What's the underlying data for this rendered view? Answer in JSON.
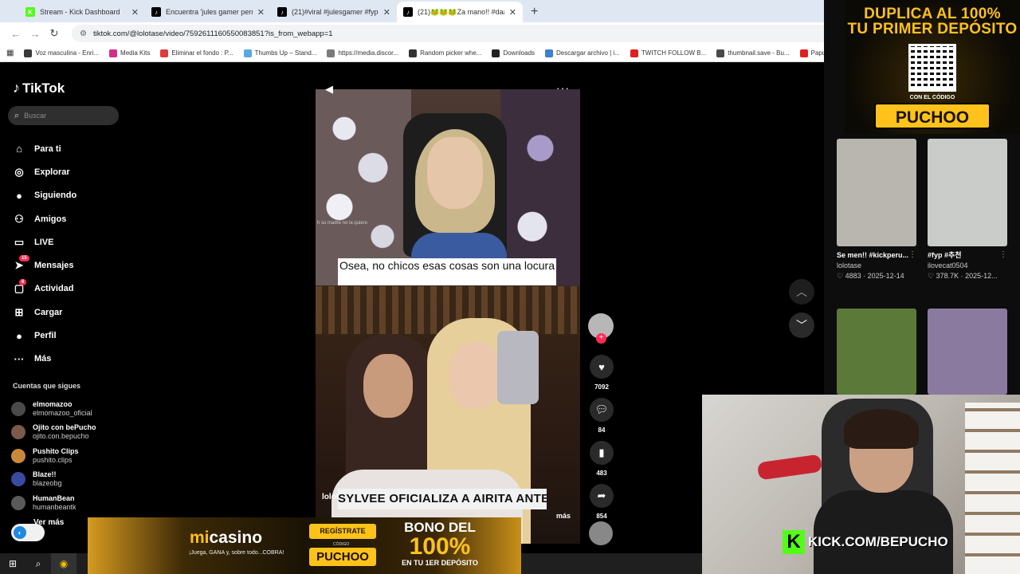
{
  "browser": {
    "tabs": [
      {
        "title": "Stream - Kick Dashboard",
        "color": "#53fc18",
        "glyph": "K"
      },
      {
        "title": "Encuentra 'jules gamer perro' e",
        "color": "#000000",
        "glyph": "♪"
      },
      {
        "title": "(21)#viral #julesgamer #fyp | ju",
        "color": "#000000",
        "glyph": "♪"
      },
      {
        "title": "(21)🐸🐸🐸Za mano!! #daaris",
        "color": "#000000",
        "glyph": "♪"
      }
    ],
    "new_tab": "+",
    "url": "tiktok.com/@lolotase/video/7592611160550083851?is_from_webapp=1",
    "bookmarks": [
      {
        "label": "Voz masculina - Enri...",
        "color": "#3a3a3a"
      },
      {
        "label": "Media Kits",
        "color": "#d0308a"
      },
      {
        "label": "Eliminar el fondo : P...",
        "color": "#e03a3a"
      },
      {
        "label": "Thumbs Up – Stand...",
        "color": "#5aa7e0"
      },
      {
        "label": "https://media.discor...",
        "color": "#7a7a7a"
      },
      {
        "label": "Random picker whe...",
        "color": "#333333"
      },
      {
        "label": "Downloads",
        "color": "#222222"
      },
      {
        "label": "Descargar archivo | i...",
        "color": "#3d7fd0"
      },
      {
        "label": "TWITCH FOLLOW B...",
        "color": "#e02020"
      },
      {
        "label": "thumbnail.save - Bu...",
        "color": "#4a4a4a"
      },
      {
        "label": "Papu! Despierta!",
        "color": "#e02020"
      }
    ]
  },
  "tiktok": {
    "logo": "TikTok",
    "search_placeholder": "Buscar",
    "nav": [
      {
        "label": "Para ti",
        "icon": "home-icon",
        "glyph": "⌂"
      },
      {
        "label": "Explorar",
        "icon": "compass-icon",
        "glyph": "◎"
      },
      {
        "label": "Siguiendo",
        "icon": "following-icon",
        "glyph": "●"
      },
      {
        "label": "Amigos",
        "icon": "friends-icon",
        "glyph": "⚇"
      },
      {
        "label": "LIVE",
        "icon": "live-icon",
        "glyph": "▭"
      },
      {
        "label": "Mensajes",
        "icon": "messages-icon",
        "glyph": "➤",
        "badge": "15"
      },
      {
        "label": "Actividad",
        "icon": "activity-icon",
        "glyph": "▢",
        "badge": "6"
      },
      {
        "label": "Cargar",
        "icon": "upload-icon",
        "glyph": "⊞"
      },
      {
        "label": "Perfil",
        "icon": "profile-icon",
        "glyph": "●"
      },
      {
        "label": "Más",
        "icon": "more-icon",
        "glyph": "···"
      }
    ],
    "following_title": "Cuentas que sigues",
    "following": [
      {
        "name": "elmomazoo",
        "handle": "elmomazoo_oficial",
        "color": "#4a4a4a"
      },
      {
        "name": "Ojito con bePucho",
        "handle": "ojito.con.bepucho",
        "color": "#7a5a4a"
      },
      {
        "name": "Pushito Clips",
        "handle": "pushito.clips",
        "color": "#c88a3a"
      },
      {
        "name": "Blaze!!",
        "handle": "blazeobg",
        "color": "#3a4aa0"
      },
      {
        "name": "HumanBean",
        "handle": "humanbeantk",
        "color": "#5a5a5a"
      }
    ],
    "see_more": "Ver más"
  },
  "video": {
    "caption_top": "Osea, no chicos esas cosas son una locura",
    "small_overlay": "h su madre no la quiere",
    "headline": "SYLVEE OFICIALIZA A AIRITA ANTES QUE SU NOVIO RADIEUS??",
    "author": "lolotase",
    "more": "más",
    "likes": "7092",
    "comments": "84",
    "saves": "483",
    "shares": "854",
    "progress": 0.2
  },
  "recommendations": [
    {
      "caption": "Se men!! #kickperu...",
      "user": "lolotase",
      "stats": "♡ 4883 · 2025-12-14",
      "color": "#b9b6b0"
    },
    {
      "caption": "#fyp #추천",
      "user": "ilovecat0504",
      "stats": "♡ 378.7K · 2025-12...",
      "color": "#c9ccc8"
    },
    {
      "caption": "",
      "user": "",
      "stats": "",
      "color": "#5b7a3a"
    },
    {
      "caption": "",
      "user": "",
      "stats": "",
      "color": "#8a7aa0"
    }
  ],
  "promo": {
    "headline_1": "DUPLICA AL 100%",
    "headline_2": "TU PRIMER DEPÓSITO",
    "code_label": "CON EL CÓDIGO",
    "code": "PUCHOO"
  },
  "banner": {
    "brand_m": "mi",
    "brand_rest": "casino",
    "tagline": "¡Juega, GANA y, sobre todo...COBRA!",
    "register": "REGÍSTRATE",
    "code_label": "CÓDIGO",
    "code": "PUCHOO",
    "bono_1": "BONO DEL",
    "bono_2": "100%",
    "bono_3": "EN TU 1ER DEPÓSITO"
  },
  "overlay": {
    "kick_url": "KICK.COM/BEPUCHO"
  }
}
